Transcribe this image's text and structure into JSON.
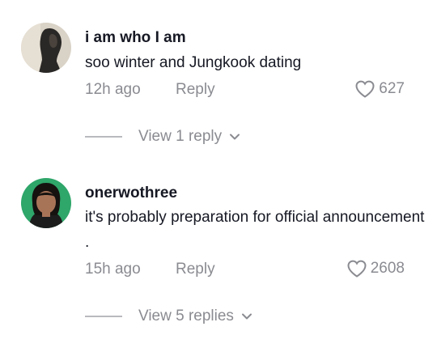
{
  "comments": [
    {
      "username": "i am who I am",
      "text": "soo winter and Jungkook dating",
      "time": "12h ago",
      "reply_label": "Reply",
      "likes": "627",
      "view_replies": "View 1 reply",
      "avatar_icon": "user-avatar"
    },
    {
      "username": "onerwothree",
      "text": "it's probably preparation for official announcement .",
      "time": "15h ago",
      "reply_label": "Reply",
      "likes": "2608",
      "view_replies": "View 5 replies",
      "avatar_icon": "user-avatar"
    }
  ],
  "colors": {
    "primary_text": "#161823",
    "secondary_text": "#8a8b91",
    "divider": "#b9babe"
  }
}
